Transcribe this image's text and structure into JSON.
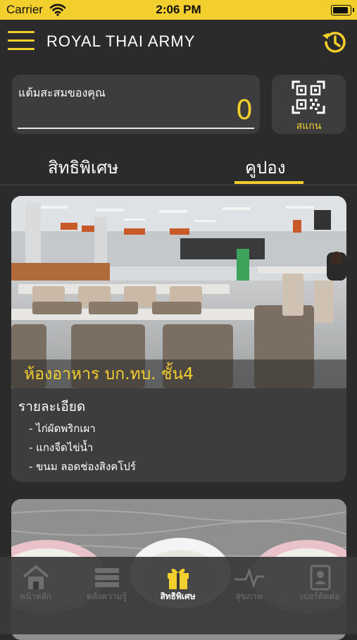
{
  "status_bar": {
    "carrier": "Carrier",
    "time": "2:06 PM"
  },
  "nav": {
    "title": "ROYAL THAI ARMY"
  },
  "points": {
    "label": "แต้มสะสมของคุณ",
    "value": "0"
  },
  "scan": {
    "label": "สแกน"
  },
  "tabs": {
    "privilege": "สิทธิพิเศษ",
    "coupon": "คูปอง",
    "active": "coupon"
  },
  "coupon_card": {
    "title": "ห้องอาหาร บก.ทบ. ชั้น4",
    "detail_heading": "รายละเอียด",
    "items": [
      "- ไก่ผัดพริกเผา",
      "- แกงจืดไข่น้ำ",
      "- ขนม ลอดช่องสิงคโปร์"
    ]
  },
  "tab_bar": {
    "items": [
      {
        "label": "หน้าหลัก",
        "icon": "home-icon"
      },
      {
        "label": "คลังความรู้",
        "icon": "library-icon"
      },
      {
        "label": "สิทธิพิเศษ",
        "icon": "gift-icon"
      },
      {
        "label": "สุขภาพ",
        "icon": "heartbeat-icon"
      },
      {
        "label": "เบอร์ติดต่อ",
        "icon": "contacts-icon"
      }
    ],
    "active_index": 2
  },
  "colors": {
    "accent": "#f3cf2e",
    "background": "#2b2b2b",
    "card": "#3d3d3d"
  }
}
